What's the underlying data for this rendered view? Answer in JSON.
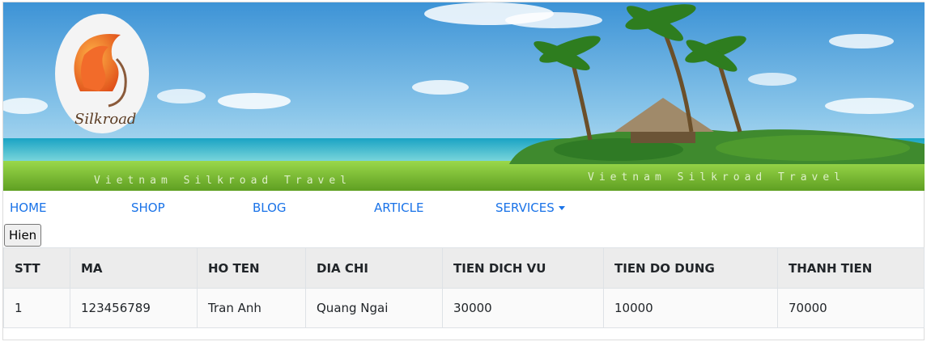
{
  "banner": {
    "logo_text": "Silkroad",
    "tagline_left": "Vietnam Silkroad Travel",
    "tagline_right": "Vietnam Silkroad Travel"
  },
  "nav": {
    "items": [
      {
        "label": "HOME"
      },
      {
        "label": "SHOP"
      },
      {
        "label": "BLOG"
      },
      {
        "label": "ARTICLE"
      },
      {
        "label": "SERVICES"
      }
    ]
  },
  "button": {
    "label": "Hien"
  },
  "table": {
    "headers": [
      "STT",
      "MA",
      "HO TEN",
      "DIA CHI",
      "TIEN DICH VU",
      "TIEN DO DUNG",
      "THANH TIEN"
    ],
    "rows": [
      [
        "1",
        "123456789",
        "Tran Anh",
        "Quang Ngai",
        "30000",
        "10000",
        "70000"
      ]
    ]
  },
  "colors": {
    "link": "#1a73e8",
    "sky": "#4ea3dc",
    "sea": "#3fb8d1",
    "grass": "#7cc634"
  }
}
